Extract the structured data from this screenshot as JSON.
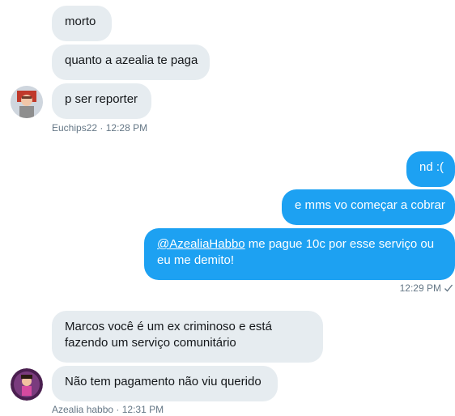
{
  "thread": {
    "group1": {
      "messages": [
        "morto",
        "quanto a azealia te paga",
        "p ser reporter"
      ],
      "sender": "Euchips22",
      "time": "12:28 PM",
      "separator": " · "
    },
    "group2": {
      "messages": [
        "nd :(",
        "e mms vo começar a cobrar"
      ],
      "mention": "@AzealiaHabbo",
      "long_message_line1": " me pague 10c por esse serviço ou",
      "long_message_line2": "eu me demito!",
      "time": "12:29 PM",
      "status_icon": "checkmark-icon"
    },
    "group3": {
      "message1_line1": "Marcos você é um ex criminoso e está",
      "message1_line2": "fazendo um serviço comunitário",
      "message2": "Não tem pagamento não viu querido",
      "sender": "Azealia habbo",
      "time": "12:31 PM",
      "separator": " · "
    }
  },
  "colors": {
    "incoming_bubble": "#e6ecf0",
    "outgoing_bubble": "#1da1f2",
    "meta_text": "#657786"
  }
}
